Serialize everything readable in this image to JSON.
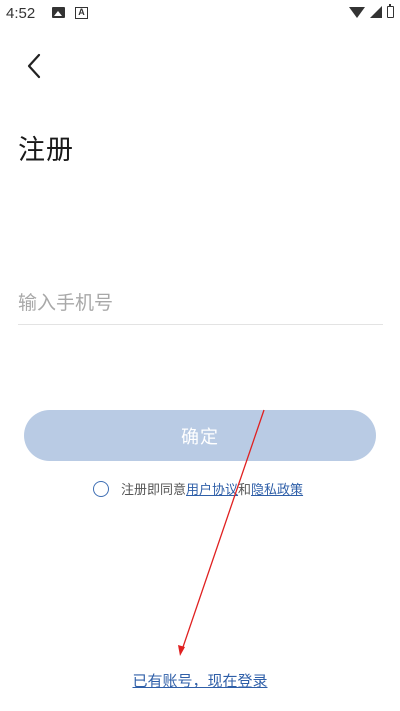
{
  "status_bar": {
    "time": "4:52"
  },
  "header": {
    "title": "注册"
  },
  "form": {
    "phone_placeholder": "输入手机号",
    "confirm_label": "确定"
  },
  "agreement": {
    "prefix": "注册即同意",
    "user_agreement": "用户协议",
    "conjunction": "和",
    "privacy_policy": "隐私政策"
  },
  "footer": {
    "login_link": "已有账号，现在登录"
  },
  "colors": {
    "button_disabled": "#b9cbe4",
    "link": "#2f5fa8",
    "annotation_arrow": "#e02020"
  }
}
